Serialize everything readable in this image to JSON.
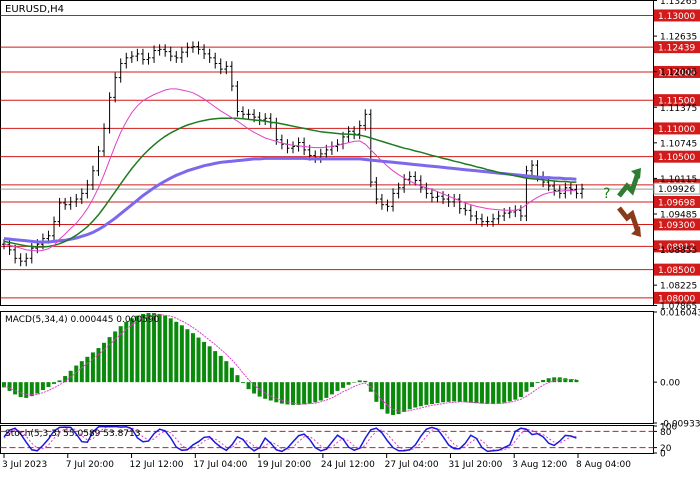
{
  "chart_data": {
    "type": "line",
    "title": "EURUSD,H4",
    "x_tick_labels": [
      "3 Jul 2023",
      "7 Jul 20:00",
      "12 Jul 12:00",
      "17 Jul 04:00",
      "19 Jul 20:00",
      "24 Jul 12:00",
      "27 Jul 04:00",
      "31 Jul 20:00",
      "3 Aug 12:00",
      "8 Aug 04:00"
    ],
    "price": {
      "ylim": [
        1.07865,
        1.13265
      ],
      "axis_ticks": [
        "1.13265",
        "1.12635",
        "1.12005",
        "1.11375",
        "1.10745",
        "1.10115",
        "1.09485",
        "1.08855",
        "1.08225",
        "1.07865"
      ],
      "levels": [
        {
          "value": 1.13,
          "label": "1.13000"
        },
        {
          "value": 1.12439,
          "label": "1.12439"
        },
        {
          "value": 1.12,
          "label": "1.12000"
        },
        {
          "value": 1.115,
          "label": "1.11500"
        },
        {
          "value": 1.11,
          "label": "1.11000"
        },
        {
          "value": 1.105,
          "label": "1.10500"
        },
        {
          "value": 1.1,
          "label": "1.10000"
        },
        {
          "value": 1.09698,
          "label": "1.09698"
        },
        {
          "value": 1.093,
          "label": "1.09300"
        },
        {
          "value": 1.08912,
          "label": "1.08912"
        },
        {
          "value": 1.085,
          "label": "1.08500"
        },
        {
          "value": 1.08,
          "label": "1.08000"
        }
      ],
      "current": {
        "value": 1.09926,
        "label": "1.09926"
      },
      "close": [
        1.0895,
        1.0885,
        1.087,
        1.0865,
        1.087,
        1.0888,
        1.0895,
        1.0905,
        1.091,
        1.0935,
        1.0968,
        1.0965,
        1.097,
        1.0975,
        1.0985,
        1.1,
        1.1025,
        1.106,
        1.11,
        1.1155,
        1.119,
        1.1215,
        1.1225,
        1.1228,
        1.1232,
        1.1222,
        1.1225,
        1.1238,
        1.124,
        1.1236,
        1.1228,
        1.1225,
        1.1235,
        1.1243,
        1.1245,
        1.124,
        1.1232,
        1.1225,
        1.1215,
        1.1205,
        1.121,
        1.1175,
        1.113,
        1.1125,
        1.1125,
        1.112,
        1.1115,
        1.1118,
        1.111,
        1.108,
        1.1072,
        1.1065,
        1.1068,
        1.1075,
        1.1062,
        1.1052,
        1.1048,
        1.1055,
        1.1062,
        1.1068,
        1.1072,
        1.1085,
        1.1095,
        1.109,
        1.1105,
        1.1125,
        1.1005,
        1.0975,
        1.0965,
        1.0962,
        1.0985,
        1.0995,
        1.101,
        1.1015,
        1.1008,
        1.0995,
        1.0985,
        1.0978,
        1.098,
        1.0975,
        1.097,
        1.0975,
        1.0958,
        1.0955,
        1.0945,
        1.094,
        1.0935,
        1.0935,
        1.094,
        1.0945,
        1.095,
        1.0952,
        1.0955,
        1.0945,
        1.1025,
        1.1035,
        1.1015,
        1.1005,
        1.0998,
        1.099,
        1.0985,
        1.0995,
        1.0992,
        1.0985,
        1.0993
      ],
      "ma_magenta": [
        1.0895,
        1.0893,
        1.0891,
        1.0888,
        1.0885,
        1.0884,
        1.0883,
        1.0884,
        1.0887,
        1.0893,
        1.0904,
        1.0913,
        1.0923,
        1.0932,
        1.0944,
        1.0958,
        1.0975,
        1.0995,
        1.1018,
        1.1044,
        1.107,
        1.1093,
        1.1112,
        1.1128,
        1.114,
        1.1149,
        1.1155,
        1.116,
        1.1164,
        1.1168,
        1.117,
        1.117,
        1.1168,
        1.1166,
        1.1163,
        1.1158,
        1.1152,
        1.1145,
        1.1138,
        1.1131,
        1.1125,
        1.1119,
        1.1113,
        1.1106,
        1.1099,
        1.1093,
        1.1088,
        1.1083,
        1.108,
        1.1077,
        1.1074,
        1.1072,
        1.107,
        1.1069,
        1.1068,
        1.1067,
        1.1066,
        1.1066,
        1.1067,
        1.1068,
        1.107,
        1.1072,
        1.1075,
        1.1077,
        1.1078,
        1.1072,
        1.1062,
        1.1052,
        1.1042,
        1.1033,
        1.1025,
        1.1018,
        1.1012,
        1.1007,
        1.1002,
        1.0998,
        1.0995,
        1.0992,
        1.0988,
        1.0984,
        1.098,
        1.0976,
        1.0972,
        1.0968,
        1.0965,
        1.0962,
        1.096,
        1.0958,
        1.0957,
        1.0956,
        1.0955,
        1.0955,
        1.0955,
        1.0958,
        1.0965,
        1.0972,
        1.0978,
        1.0983,
        1.0986,
        1.0988,
        1.0989,
        1.099,
        1.099,
        1.099
      ],
      "ma_green": [
        1.09,
        1.0898,
        1.0896,
        1.0894,
        1.0892,
        1.0891,
        1.089,
        1.089,
        1.0891,
        1.0893,
        1.0896,
        1.09,
        1.0905,
        1.0911,
        1.0918,
        1.0926,
        1.0936,
        1.0947,
        1.096,
        1.0974,
        1.0988,
        1.1002,
        1.1016,
        1.1029,
        1.1041,
        1.1052,
        1.1062,
        1.1071,
        1.1079,
        1.1086,
        1.1092,
        1.1097,
        1.1102,
        1.1106,
        1.1109,
        1.1112,
        1.1114,
        1.1116,
        1.1117,
        1.1118,
        1.1118,
        1.1118,
        1.1118,
        1.1117,
        1.1116,
        1.1115,
        1.1114,
        1.1113,
        1.1111,
        1.111,
        1.1108,
        1.1106,
        1.1104,
        1.1102,
        1.11,
        1.1098,
        1.1096,
        1.1094,
        1.1093,
        1.1092,
        1.1091,
        1.109,
        1.109,
        1.1089,
        1.1088,
        1.1086,
        1.1083,
        1.108,
        1.1077,
        1.1074,
        1.1071,
        1.1068,
        1.1065,
        1.1063,
        1.106,
        1.1058,
        1.1055,
        1.1052,
        1.105,
        1.1047,
        1.1045,
        1.1042,
        1.104,
        1.1037,
        1.1035,
        1.1032,
        1.103,
        1.1027,
        1.1025,
        1.1022,
        1.102,
        1.1018,
        1.1016,
        1.1014,
        1.1012,
        1.1011,
        1.101,
        1.1009,
        1.1008,
        1.1007,
        1.1006,
        1.1006,
        1.1005,
        1.1005
      ],
      "ma_blue": [
        1.0905,
        1.0904,
        1.0903,
        1.0902,
        1.0901,
        1.09,
        1.0899,
        1.0899,
        1.0899,
        1.09,
        1.0901,
        1.0902,
        1.0904,
        1.0906,
        1.0909,
        1.0912,
        1.0916,
        1.0921,
        1.0927,
        1.0934,
        1.0941,
        1.0949,
        1.0957,
        1.0965,
        1.0973,
        1.0981,
        1.0988,
        1.0995,
        1.1001,
        1.1007,
        1.1012,
        1.1017,
        1.1021,
        1.1025,
        1.1028,
        1.1031,
        1.1034,
        1.1036,
        1.1038,
        1.104,
        1.1041,
        1.1042,
        1.1043,
        1.1044,
        1.1045,
        1.1046,
        1.1046,
        1.1047,
        1.1047,
        1.1047,
        1.1047,
        1.1047,
        1.1047,
        1.1047,
        1.1047,
        1.1046,
        1.1046,
        1.1046,
        1.1046,
        1.1046,
        1.1046,
        1.1046,
        1.1046,
        1.1046,
        1.1046,
        1.1045,
        1.1044,
        1.1043,
        1.1042,
        1.1041,
        1.104,
        1.1039,
        1.1038,
        1.1037,
        1.1036,
        1.1035,
        1.1034,
        1.1033,
        1.1032,
        1.1031,
        1.103,
        1.1029,
        1.1028,
        1.1027,
        1.1026,
        1.1025,
        1.1024,
        1.1023,
        1.1022,
        1.1021,
        1.102,
        1.1019,
        1.1018,
        1.1017,
        1.1016,
        1.1015,
        1.1014,
        1.1013,
        1.1013,
        1.1012,
        1.1012,
        1.1011,
        1.1011,
        1.101
      ],
      "pointer_up_color": "#2e7d32",
      "pointer_down_color": "#8b3a1a",
      "pointer_label": "?"
    },
    "macd": {
      "label": "MACD(5,34,4) 0.000445 0.000590",
      "ylim": [
        -0.009339,
        0.016043
      ],
      "axis_ticks": [
        "0.016043",
        "0.00",
        "-0.009339"
      ],
      "histogram": [
        -0.0012,
        -0.002,
        -0.0028,
        -0.0034,
        -0.0036,
        -0.0032,
        -0.0026,
        -0.0018,
        -0.0011,
        -0.0004,
        0.0004,
        0.0014,
        0.0026,
        0.0038,
        0.0048,
        0.0058,
        0.0068,
        0.0078,
        0.009,
        0.0103,
        0.0116,
        0.0128,
        0.0138,
        0.0146,
        0.0152,
        0.0156,
        0.0158,
        0.0158,
        0.0156,
        0.0152,
        0.0146,
        0.0138,
        0.013,
        0.0121,
        0.0112,
        0.0102,
        0.0092,
        0.0082,
        0.0071,
        0.006,
        0.0048,
        0.0033,
        0.0016,
        -0.0002,
        -0.0016,
        -0.0026,
        -0.0033,
        -0.0038,
        -0.0042,
        -0.0046,
        -0.0049,
        -0.0051,
        -0.0052,
        -0.0052,
        -0.0051,
        -0.0049,
        -0.0046,
        -0.0042,
        -0.0036,
        -0.0028,
        -0.002,
        -0.0013,
        -0.0006,
        0.0,
        0.0004,
        0.0003,
        -0.0022,
        -0.0045,
        -0.0062,
        -0.0072,
        -0.0075,
        -0.0073,
        -0.0068,
        -0.0062,
        -0.0058,
        -0.0055,
        -0.0052,
        -0.005,
        -0.0048,
        -0.0046,
        -0.0045,
        -0.0044,
        -0.0045,
        -0.0046,
        -0.0047,
        -0.0048,
        -0.0049,
        -0.005,
        -0.005,
        -0.0049,
        -0.0047,
        -0.0044,
        -0.004,
        -0.0034,
        -0.0022,
        -0.0011,
        -0.0002,
        0.0005,
        0.0009,
        0.0011,
        0.0011,
        0.0009,
        0.0007,
        0.0005
      ],
      "signal": [
        -0.0008,
        -0.0013,
        -0.0019,
        -0.0024,
        -0.0028,
        -0.0029,
        -0.0028,
        -0.0024,
        -0.0019,
        -0.0013,
        -0.0006,
        0.0002,
        0.0012,
        0.0022,
        0.0033,
        0.0043,
        0.0053,
        0.0063,
        0.0074,
        0.0086,
        0.0098,
        0.011,
        0.0121,
        0.0131,
        0.0139,
        0.0145,
        0.015,
        0.0153,
        0.0154,
        0.0153,
        0.0151,
        0.0146,
        0.014,
        0.0133,
        0.0125,
        0.0116,
        0.0106,
        0.0096,
        0.0086,
        0.0075,
        0.0064,
        0.0051,
        0.0037,
        0.0021,
        0.0006,
        -0.0007,
        -0.0017,
        -0.0025,
        -0.0032,
        -0.0037,
        -0.0042,
        -0.0045,
        -0.0048,
        -0.005,
        -0.005,
        -0.0049,
        -0.0048,
        -0.0045,
        -0.0041,
        -0.0036,
        -0.0029,
        -0.0022,
        -0.0016,
        -0.001,
        -0.0005,
        -0.0002,
        -0.0012,
        -0.0026,
        -0.0041,
        -0.0053,
        -0.0062,
        -0.0066,
        -0.0067,
        -0.0065,
        -0.0062,
        -0.0059,
        -0.0056,
        -0.0053,
        -0.0051,
        -0.0049,
        -0.0047,
        -0.0046,
        -0.0045,
        -0.0045,
        -0.0046,
        -0.0047,
        -0.0048,
        -0.0048,
        -0.0049,
        -0.0049,
        -0.0048,
        -0.0046,
        -0.0043,
        -0.0039,
        -0.0032,
        -0.0024,
        -0.0015,
        -0.0007,
        -0.0001,
        0.0003,
        0.0006,
        0.0006,
        0.0006,
        0.0006
      ]
    },
    "stoch": {
      "label": "Stoch(5,3,3) 55.0589 53.8713",
      "ylim": [
        0,
        100
      ],
      "axis_ticks": [
        "100",
        "80",
        "20",
        "0"
      ],
      "levels": [
        80,
        20
      ],
      "main": [
        60,
        85,
        92,
        70,
        40,
        12,
        8,
        28,
        52,
        82,
        95,
        96,
        95,
        70,
        42,
        40,
        78,
        97,
        98,
        97,
        98,
        96,
        97,
        90,
        56,
        42,
        44,
        72,
        88,
        82,
        56,
        22,
        10,
        12,
        30,
        42,
        58,
        60,
        38,
        22,
        10,
        30,
        60,
        50,
        24,
        8,
        20,
        55,
        36,
        12,
        6,
        18,
        42,
        64,
        70,
        50,
        20,
        8,
        14,
        40,
        66,
        52,
        22,
        10,
        18,
        55,
        86,
        92,
        75,
        45,
        20,
        8,
        8,
        12,
        30,
        62,
        88,
        95,
        88,
        60,
        30,
        16,
        16,
        36,
        66,
        54,
        20,
        6,
        8,
        10,
        20,
        30,
        80,
        92,
        88,
        68,
        72,
        60,
        36,
        28,
        44,
        65,
        63,
        55
      ],
      "signal": [
        55,
        72,
        86,
        82,
        62,
        36,
        18,
        16,
        30,
        54,
        76,
        90,
        95,
        85,
        64,
        48,
        52,
        76,
        92,
        97,
        97,
        97,
        97,
        94,
        78,
        60,
        48,
        52,
        70,
        82,
        75,
        52,
        28,
        14,
        16,
        28,
        44,
        54,
        52,
        38,
        22,
        20,
        36,
        50,
        42,
        26,
        16,
        28,
        40,
        32,
        16,
        12,
        22,
        42,
        60,
        62,
        46,
        26,
        14,
        20,
        40,
        54,
        46,
        26,
        16,
        28,
        58,
        80,
        86,
        70,
        46,
        24,
        12,
        10,
        18,
        36,
        62,
        84,
        92,
        80,
        56,
        32,
        20,
        22,
        40,
        54,
        46,
        26,
        12,
        10,
        12,
        20,
        44,
        72,
        88,
        84,
        74,
        68,
        54,
        40,
        36,
        48,
        60,
        61
      ]
    }
  }
}
